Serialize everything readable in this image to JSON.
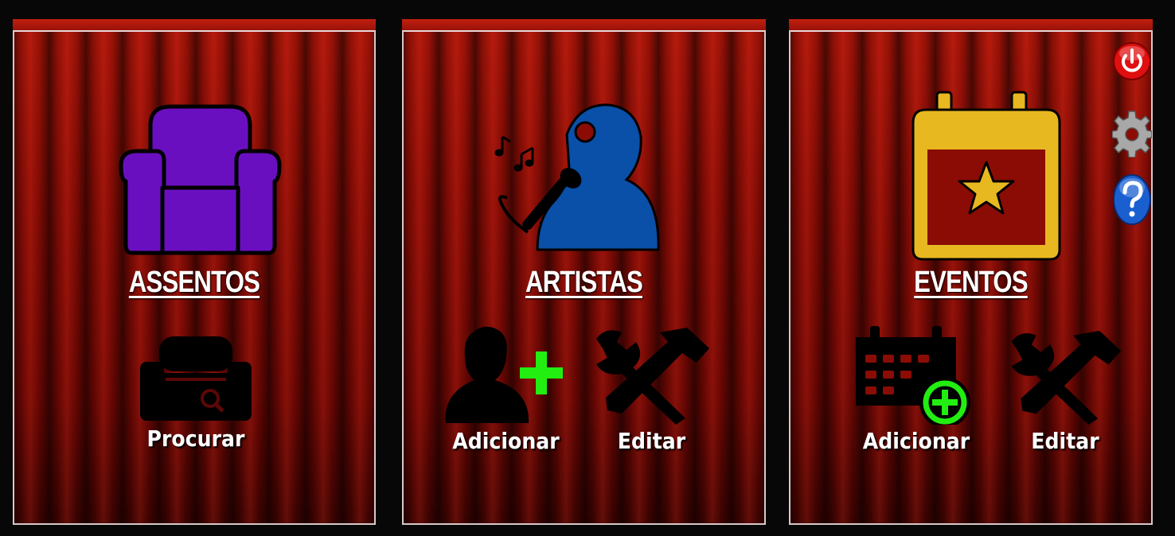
{
  "panels": [
    {
      "title": "ASSENTOS",
      "main_icon": "armchair-icon",
      "actions": [
        {
          "label": "Procurar",
          "icon": "armchair-search-icon"
        }
      ]
    },
    {
      "title": "ARTISTAS",
      "main_icon": "singer-microphone-icon",
      "actions": [
        {
          "label": "Adicionar",
          "icon": "add-user-icon"
        },
        {
          "label": "Editar",
          "icon": "tools-icon"
        }
      ]
    },
    {
      "title": "EVENTOS",
      "main_icon": "calendar-star-icon",
      "actions": [
        {
          "label": "Adicionar",
          "icon": "calendar-add-icon"
        },
        {
          "label": "Editar",
          "icon": "tools-icon"
        }
      ]
    }
  ],
  "side_buttons": [
    {
      "icon": "power-icon"
    },
    {
      "icon": "gear-icon"
    },
    {
      "icon": "help-icon"
    }
  ],
  "colors": {
    "armchair": "#6a0fc0",
    "singer": "#0a4fa8",
    "calendar": "#e8b820",
    "add_green": "#22ee11",
    "power_red": "#e01010",
    "help_blue": "#1a5fd0"
  }
}
